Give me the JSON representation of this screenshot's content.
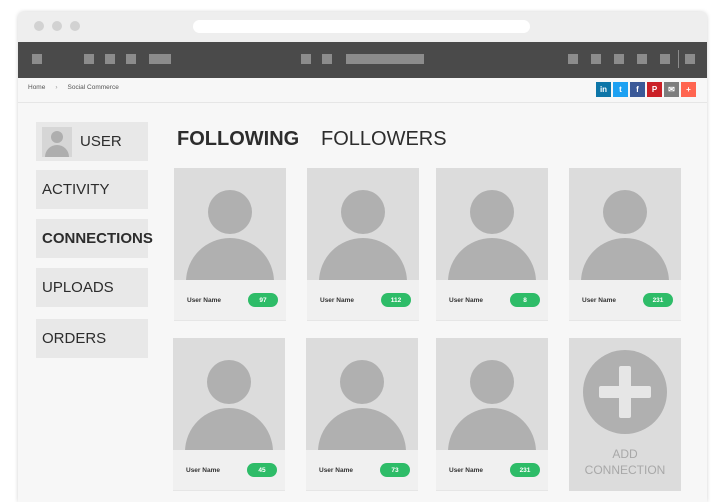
{
  "breadcrumb": {
    "home": "Home",
    "separator": "›",
    "current": "Social Commerce"
  },
  "share_buttons": [
    {
      "icon": "linkedin-icon",
      "glyph": "in",
      "color": "#0e76a8"
    },
    {
      "icon": "twitter-icon",
      "glyph": "t",
      "color": "#1da1f2"
    },
    {
      "icon": "facebook-icon",
      "glyph": "f",
      "color": "#3b5998"
    },
    {
      "icon": "pinterest-icon",
      "glyph": "P",
      "color": "#cb2027"
    },
    {
      "icon": "email-icon",
      "glyph": "✉",
      "color": "#7d7d7d"
    },
    {
      "icon": "plus-share-icon",
      "glyph": "+",
      "color": "#ff6550"
    }
  ],
  "sidebar": {
    "items": [
      {
        "label": "USER",
        "active": false
      },
      {
        "label": "ACTIVITY",
        "active": false
      },
      {
        "label": "CONNECTIONS",
        "active": true
      },
      {
        "label": "UPLOADS",
        "active": false
      },
      {
        "label": "ORDERS",
        "active": false
      }
    ]
  },
  "tabs": [
    {
      "label": "FOLLOWING",
      "active": true
    },
    {
      "label": "FOLLOWERS",
      "active": false
    }
  ],
  "users": [
    {
      "name": "User Name",
      "count": "97"
    },
    {
      "name": "User Name",
      "count": "112"
    },
    {
      "name": "User Name",
      "count": "8"
    },
    {
      "name": "User Name",
      "count": "231"
    },
    {
      "name": "User Name",
      "count": "45"
    },
    {
      "name": "User Name",
      "count": "73"
    },
    {
      "name": "User Name",
      "count": "231"
    }
  ],
  "add_card": {
    "line1": "ADD",
    "line2": "CONNECTION"
  },
  "colors": {
    "badge": "#2ebc68",
    "navbar": "#4a4a4a"
  }
}
